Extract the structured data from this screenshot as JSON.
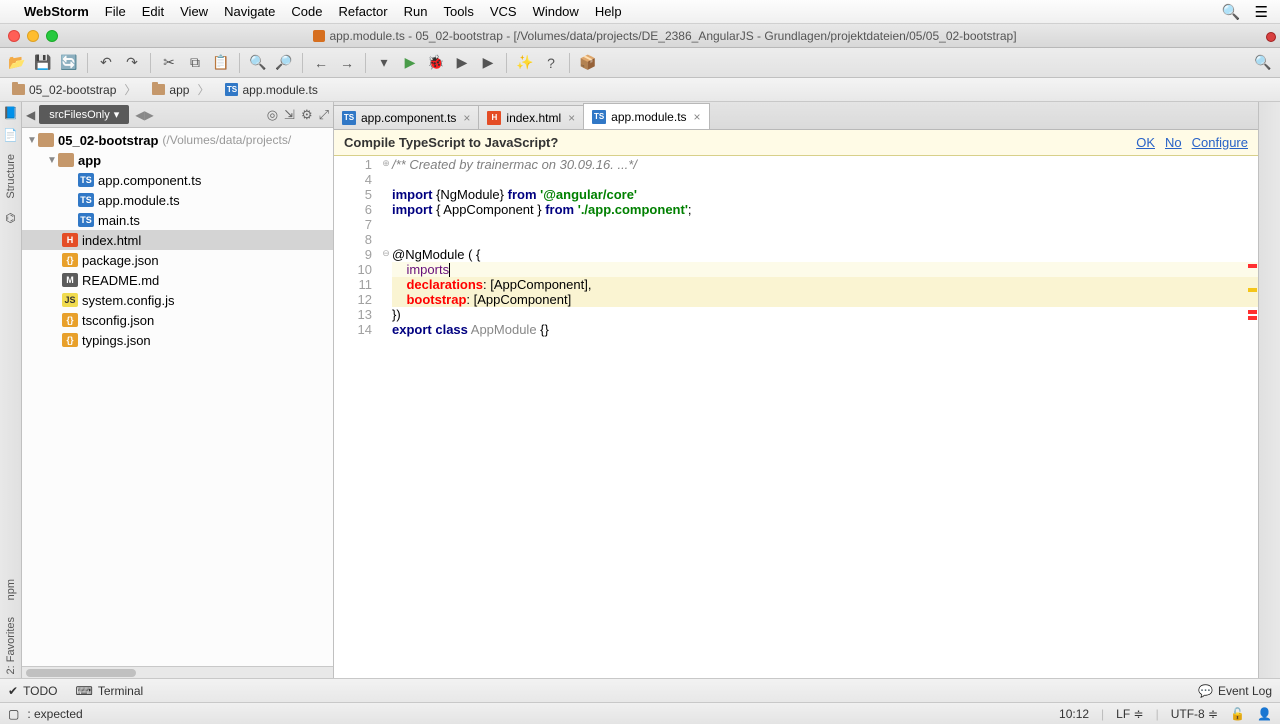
{
  "menubar": {
    "app": "WebStorm",
    "items": [
      "File",
      "Edit",
      "View",
      "Navigate",
      "Code",
      "Refactor",
      "Run",
      "Tools",
      "VCS",
      "Window",
      "Help"
    ]
  },
  "window": {
    "title": "app.module.ts - 05_02-bootstrap - [/Volumes/data/projects/DE_2386_AngularJS - Grundlagen/projektdateien/05/05_02-bootstrap]"
  },
  "breadcrumb": {
    "project": "05_02-bootstrap",
    "folder": "app",
    "file": "app.module.ts"
  },
  "project_panel": {
    "scope_label": "srcFilesOnly",
    "root": {
      "name": "05_02-bootstrap",
      "path": "(/Volumes/data/projects/"
    },
    "app_folder": "app",
    "files": {
      "app_component": "app.component.ts",
      "app_module": "app.module.ts",
      "main_ts": "main.ts",
      "index_html": "index.html",
      "package_json": "package.json",
      "readme": "README.md",
      "system_config": "system.config.js",
      "tsconfig": "tsconfig.json",
      "typings": "typings.json"
    }
  },
  "side_tabs": {
    "project": "Project",
    "structure": "Structure",
    "favorites": "2: Favorites",
    "npm": "npm"
  },
  "editor": {
    "tabs": {
      "t1": "app.component.ts",
      "t2": "index.html",
      "t3": "app.module.ts"
    },
    "notification": {
      "text": "Compile TypeScript to JavaScript?",
      "ok": "OK",
      "no": "No",
      "config": "Configure"
    },
    "code": {
      "l1_doc": "/** Created by trainermac on 30.09.16. ...*/",
      "l5_a": "import",
      "l5_b": " {NgModule} ",
      "l5_c": "from",
      "l5_d": " '@angular/core'",
      "l6_a": "import",
      "l6_b": " { AppComponent } ",
      "l6_c": "from",
      "l6_d": " './app.component'",
      "l6_e": ";",
      "l9_a": "@NgModule ( {",
      "l10_a": "imports",
      "l11_a": "declarations",
      "l11_b": ": [AppComponent],",
      "l12_a": "bootstrap",
      "l12_b": ": [AppComponent]",
      "l13_a": "})",
      "l14_a": "export",
      "l14_b": " class",
      "l14_c": " AppModule ",
      "l14_d": "{}"
    },
    "line_numbers": [
      "1",
      "4",
      "5",
      "6",
      "7",
      "8",
      "9",
      "10",
      "11",
      "12",
      "13",
      "14"
    ]
  },
  "bottom": {
    "todo": "TODO",
    "terminal": "Terminal",
    "event_log": "Event Log"
  },
  "status": {
    "message": ": expected",
    "position": "10:12",
    "line_sep": "LF",
    "encoding": "UTF-8"
  }
}
